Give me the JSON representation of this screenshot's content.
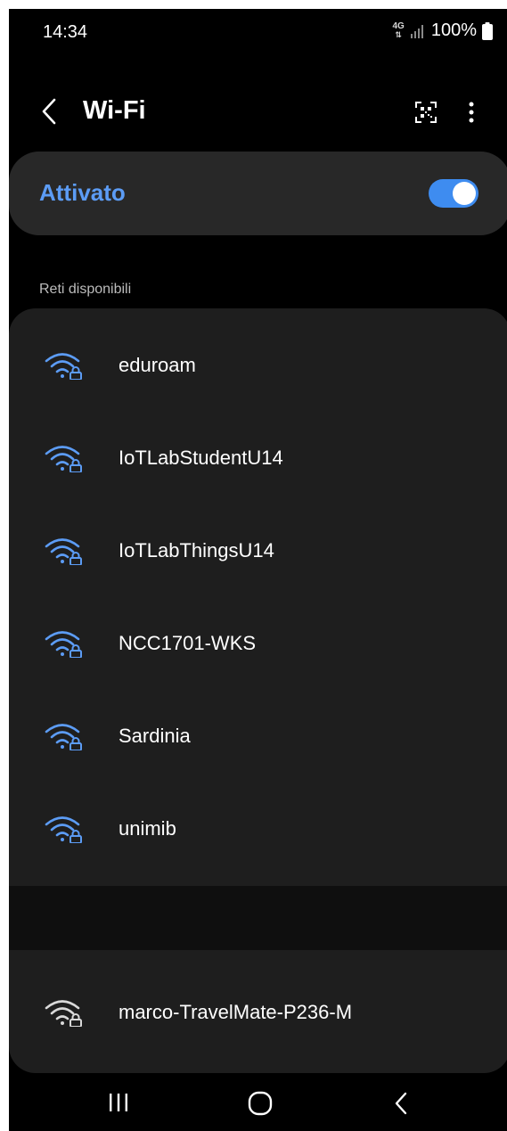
{
  "status_bar": {
    "time": "14:34",
    "network_type": "4G",
    "battery": "100%"
  },
  "header": {
    "title": "Wi-Fi",
    "back_icon": "chevron-left-icon",
    "qr_icon": "qr-code-scanner-icon",
    "more_icon": "more-vertical-icon"
  },
  "wifi_toggle": {
    "label": "Attivato",
    "state": "on"
  },
  "available": {
    "section_label": "Reti disponibili",
    "networks": [
      {
        "ssid": "eduroam",
        "secured": true
      },
      {
        "ssid": "IoTLabStudentU14",
        "secured": true
      },
      {
        "ssid": "IoTLabThingsU14",
        "secured": true
      },
      {
        "ssid": "NCC1701-WKS",
        "secured": true
      },
      {
        "ssid": "Sardinia",
        "secured": true
      },
      {
        "ssid": "unimib",
        "secured": true
      }
    ]
  },
  "saved": {
    "networks": [
      {
        "ssid": "marco-TravelMate-P236-M",
        "secured": true
      }
    ]
  },
  "nav_bar": {
    "recent_icon": "recent-apps-icon",
    "home_icon": "home-icon",
    "back_icon": "back-icon"
  },
  "colors": {
    "accent": "#5c9cf5",
    "toggle_track": "#3e8cf0",
    "card": "#1e1e1e",
    "toggle_card": "#282828",
    "background": "#000000",
    "saved_icon": "#d9d9d9"
  }
}
